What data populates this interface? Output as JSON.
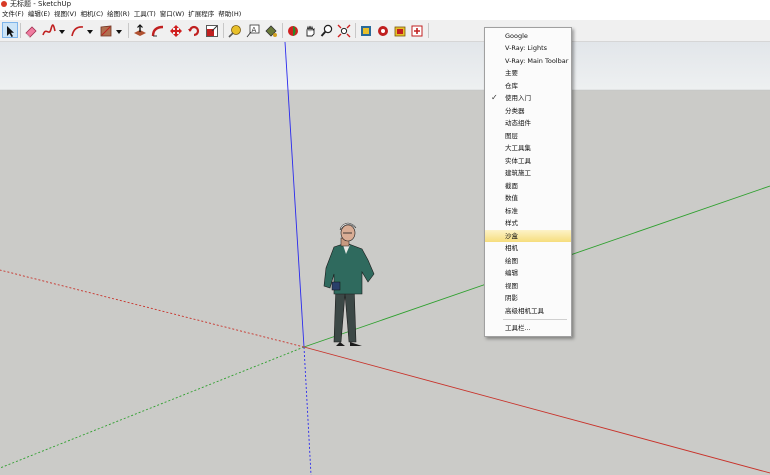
{
  "window": {
    "title": "无标题 - SketchUp",
    "app_icon": "sketchup-logo-icon"
  },
  "menubar": {
    "items": [
      "文件(F)",
      "编辑(E)",
      "视图(V)",
      "相机(C)",
      "绘图(R)",
      "工具(T)",
      "窗口(W)",
      "扩展程序",
      "帮助(H)"
    ]
  },
  "toolbar": {
    "tools": [
      "select-tool-icon",
      "eraser-tool-icon",
      "freehand-tool-icon",
      "arc-tool-icon",
      "rectangle-tool-icon",
      "push-pull-tool-icon",
      "follow-me-tool-icon",
      "move-tool-icon",
      "rotate-tool-icon",
      "scale-tool-icon",
      "tape-measure-tool-icon",
      "text-tool-icon",
      "paint-bucket-tool-icon",
      "orbit-tool-icon",
      "pan-tool-icon",
      "zoom-tool-icon",
      "zoom-extents-tool-icon",
      "3d-warehouse-icon",
      "extension-warehouse-icon",
      "layout-send-icon",
      "extension-manager-icon"
    ]
  },
  "context_menu": {
    "items": [
      {
        "label": "Google"
      },
      {
        "label": "V-Ray: Lights"
      },
      {
        "label": "V-Ray: Main Toolbar"
      },
      {
        "label": "主要"
      },
      {
        "label": "仓库"
      },
      {
        "label": "使用入门",
        "checked": true,
        "check_mark": "✓"
      },
      {
        "label": "分类器"
      },
      {
        "label": "动态组件"
      },
      {
        "label": "图层"
      },
      {
        "label": "大工具集"
      },
      {
        "label": "实体工具"
      },
      {
        "label": "建筑施工"
      },
      {
        "label": "截面"
      },
      {
        "label": "数值"
      },
      {
        "label": "标准"
      },
      {
        "label": "样式"
      },
      {
        "label": "沙盒",
        "highlighted": true
      },
      {
        "label": "相机"
      },
      {
        "label": "绘图"
      },
      {
        "label": "编辑"
      },
      {
        "label": "视图"
      },
      {
        "label": "阴影"
      },
      {
        "label": "高级相机工具"
      },
      {
        "label": "工具栏..."
      }
    ]
  },
  "colors": {
    "background": "#cbcbc8",
    "sky": "#e9ebed",
    "x_axis": "#c8322a",
    "y_axis": "#2ea02e",
    "z_axis": "#2a2aee",
    "menu_highlight": "#f6dd7d"
  }
}
